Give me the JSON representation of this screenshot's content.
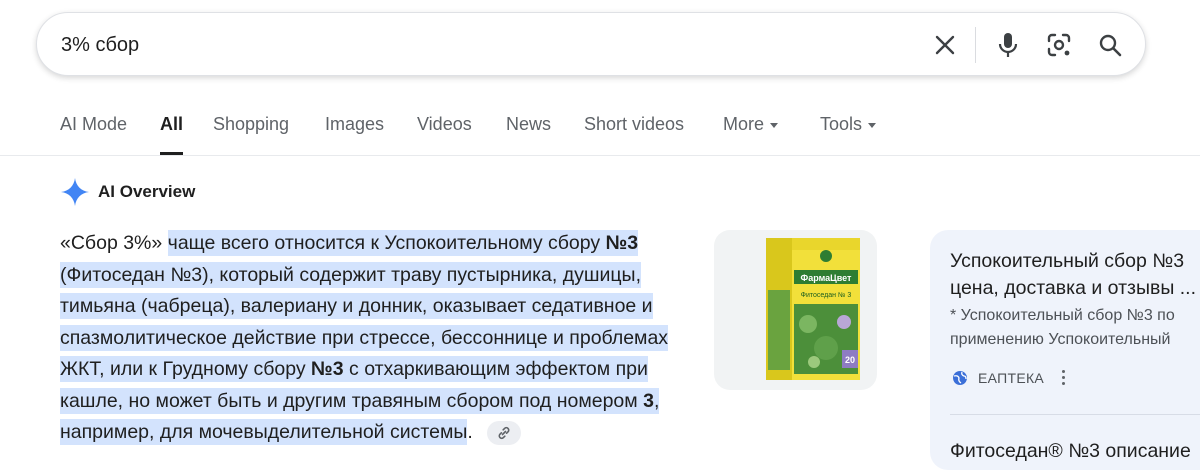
{
  "search": {
    "query": "3% сбор",
    "icons": [
      "close-icon",
      "mic-icon",
      "lens-icon",
      "search-icon"
    ]
  },
  "tabs": [
    {
      "label": "AI Mode"
    },
    {
      "label": "All",
      "active": true
    },
    {
      "label": "Shopping"
    },
    {
      "label": "Images"
    },
    {
      "label": "Videos"
    },
    {
      "label": "News"
    },
    {
      "label": "Short videos"
    },
    {
      "label": "More",
      "has_caret": true
    },
    {
      "label": "Tools",
      "has_caret": true
    }
  ],
  "ai_overview": {
    "title": "AI Overview",
    "accent_color": "#4285f4",
    "highlight_color": "#d3e3fd",
    "text": {
      "lead": "«Сбор 3%» ",
      "seg1": "чаще всего относится к Успокоительному сбору ",
      "seg1_bold": "№3",
      "seg2": " (Фитоседан №3), который содержит траву пустырника, душицы, тимьяна (чабреца), валериану и донник, оказывает седативное и спазмолитическое действие при стрессе, бессоннице и проблемах ЖКТ, или к Грудному сбору ",
      "seg2_bold": "№3",
      "seg3": " с отхаркивающим эффектом при кашле, но может быть и другим травяным сбором под номером ",
      "seg3_bold": "3",
      "seg4": ", например, для мочевыделительной системы",
      "end": "."
    },
    "thumbnail": {
      "brand": "ФармаЦвет",
      "product": "Фитоседан № 3",
      "count": "20"
    },
    "sources": [
      {
        "title_line1": "Успокоительный сбор №3",
        "title_line2": "цена, доставка и отзывы ...",
        "snippet_line1": "* Успокоительный сбор №3 по",
        "snippet_line2": "применению Успокоительный",
        "site": "ЕАПТЕКА"
      },
      {
        "title_line1": "Фитоседан® №3 описание"
      }
    ]
  }
}
